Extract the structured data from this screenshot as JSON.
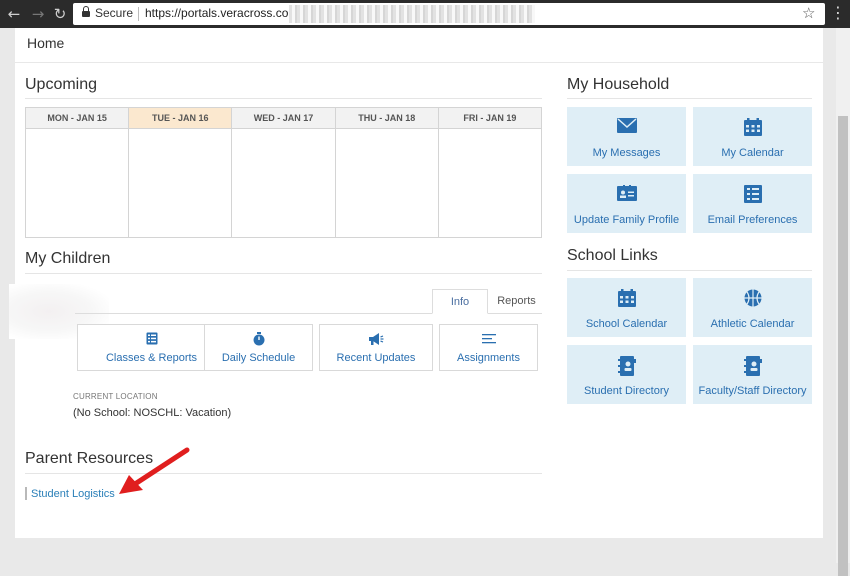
{
  "browser": {
    "secure_label": "Secure",
    "url": "https://portals.veracross.com"
  },
  "page": {
    "home_label": "Home"
  },
  "upcoming": {
    "title": "Upcoming",
    "days": [
      "MON - JAN 15",
      "TUE - JAN 16",
      "WED - JAN 17",
      "THU - JAN 18",
      "FRI - JAN 19"
    ],
    "today_index": 1
  },
  "children": {
    "title": "My Children",
    "tabs": {
      "info": "Info",
      "reports": "Reports"
    },
    "buttons": {
      "classes": "Classes & Reports",
      "schedule": "Daily Schedule",
      "updates": "Recent Updates",
      "assignments": "Assignments"
    },
    "current_location_label": "CURRENT LOCATION",
    "current_location_value": "(No School: NOSCHL: Vacation)"
  },
  "parent_resources": {
    "title": "Parent Resources",
    "link": "Student Logistics"
  },
  "household": {
    "title": "My Household",
    "tiles": {
      "messages": "My Messages",
      "calendar": "My Calendar",
      "family_profile": "Update Family Profile",
      "email_prefs": "Email Preferences"
    }
  },
  "school_links": {
    "title": "School Links",
    "tiles": {
      "school_calendar": "School Calendar",
      "athletic_calendar": "Athletic Calendar",
      "student_directory": "Student Directory",
      "staff_directory": "Faculty/Staff Directory"
    }
  },
  "colors": {
    "accent": "#2a6fb0",
    "tile_bg": "#dfeef6",
    "today_bg": "#fbe8cf",
    "arrow": "#e01e1e"
  }
}
